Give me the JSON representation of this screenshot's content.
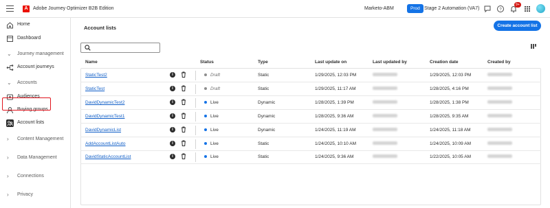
{
  "topbar": {
    "app_title": "Adobe Journey Optimizer B2B Edition",
    "logo_letter": "A",
    "org": "Marketo-ABM",
    "env_badge": "Prod",
    "sandbox": "Stage 2 Automation (VA7)",
    "notification_count": "9+",
    "icons": [
      "hamburger-icon",
      "feedback-icon",
      "help-icon",
      "bell-icon",
      "apps-grid-icon",
      "avatar"
    ],
    "colors": {
      "accent": "#1473e6",
      "brand": "#eb1000",
      "badge": "#d31510"
    }
  },
  "sidebar": {
    "items": [
      {
        "label": "Home",
        "icon": "home-icon"
      },
      {
        "label": "Dashboard",
        "icon": "dashboard-icon"
      },
      {
        "label": "Journey management",
        "icon": "chevron-down-icon",
        "section": true
      },
      {
        "label": "Account journeys",
        "icon": "journey-icon"
      },
      {
        "label": "Accounts",
        "icon": "chevron-down-icon",
        "section": true
      },
      {
        "label": "Audiences",
        "icon": "audiences-icon"
      },
      {
        "label": "Buying groups",
        "icon": "buying-groups-icon"
      },
      {
        "label": "Account lists",
        "icon": "account-lists-icon",
        "active": true
      },
      {
        "label": "Content Management",
        "icon": "chevron-right-icon",
        "section": true
      },
      {
        "label": "Data Management",
        "icon": "chevron-right-icon",
        "section": true
      },
      {
        "label": "Connections",
        "icon": "chevron-right-icon",
        "section": true
      },
      {
        "label": "Privacy",
        "icon": "chevron-right-icon",
        "section": true
      }
    ]
  },
  "main": {
    "title": "Account lists",
    "create_button": "Create account list",
    "search": {
      "value": "",
      "placeholder": ""
    },
    "columns": [
      "Name",
      "Status",
      "Type",
      "Last update on",
      "Last updated by",
      "Creation date",
      "Created by"
    ],
    "rows": [
      {
        "name": "StaticTest2",
        "status": "Draft",
        "type": "Static",
        "last_update": "1/29/2025, 12:03 PM",
        "created": "1/29/2025, 12:03 PM"
      },
      {
        "name": "StaticTest",
        "status": "Draft",
        "type": "Static",
        "last_update": "1/29/2025, 11:17 AM",
        "created": "1/28/2025, 4:16 PM"
      },
      {
        "name": "DavidDynamicTest2",
        "status": "Live",
        "type": "Dynamic",
        "last_update": "1/28/2025, 1:39 PM",
        "created": "1/28/2025, 1:38 PM"
      },
      {
        "name": "DavidDynamicTest1",
        "status": "Live",
        "type": "Dynamic",
        "last_update": "1/28/2025, 9:36 AM",
        "created": "1/28/2025, 9:35 AM"
      },
      {
        "name": "DavidDynamicList",
        "status": "Live",
        "type": "Dynamic",
        "last_update": "1/24/2025, 11:19 AM",
        "created": "1/24/2025, 11:18 AM"
      },
      {
        "name": "AddAccountListAuto",
        "status": "Live",
        "type": "Static",
        "last_update": "1/24/2025, 10:10 AM",
        "created": "1/24/2025, 10:09 AM"
      },
      {
        "name": "DavidStaticAccountList",
        "status": "Live",
        "type": "Static",
        "last_update": "1/24/2025, 9:36 AM",
        "created": "1/22/2025, 10:05 AM"
      }
    ]
  }
}
